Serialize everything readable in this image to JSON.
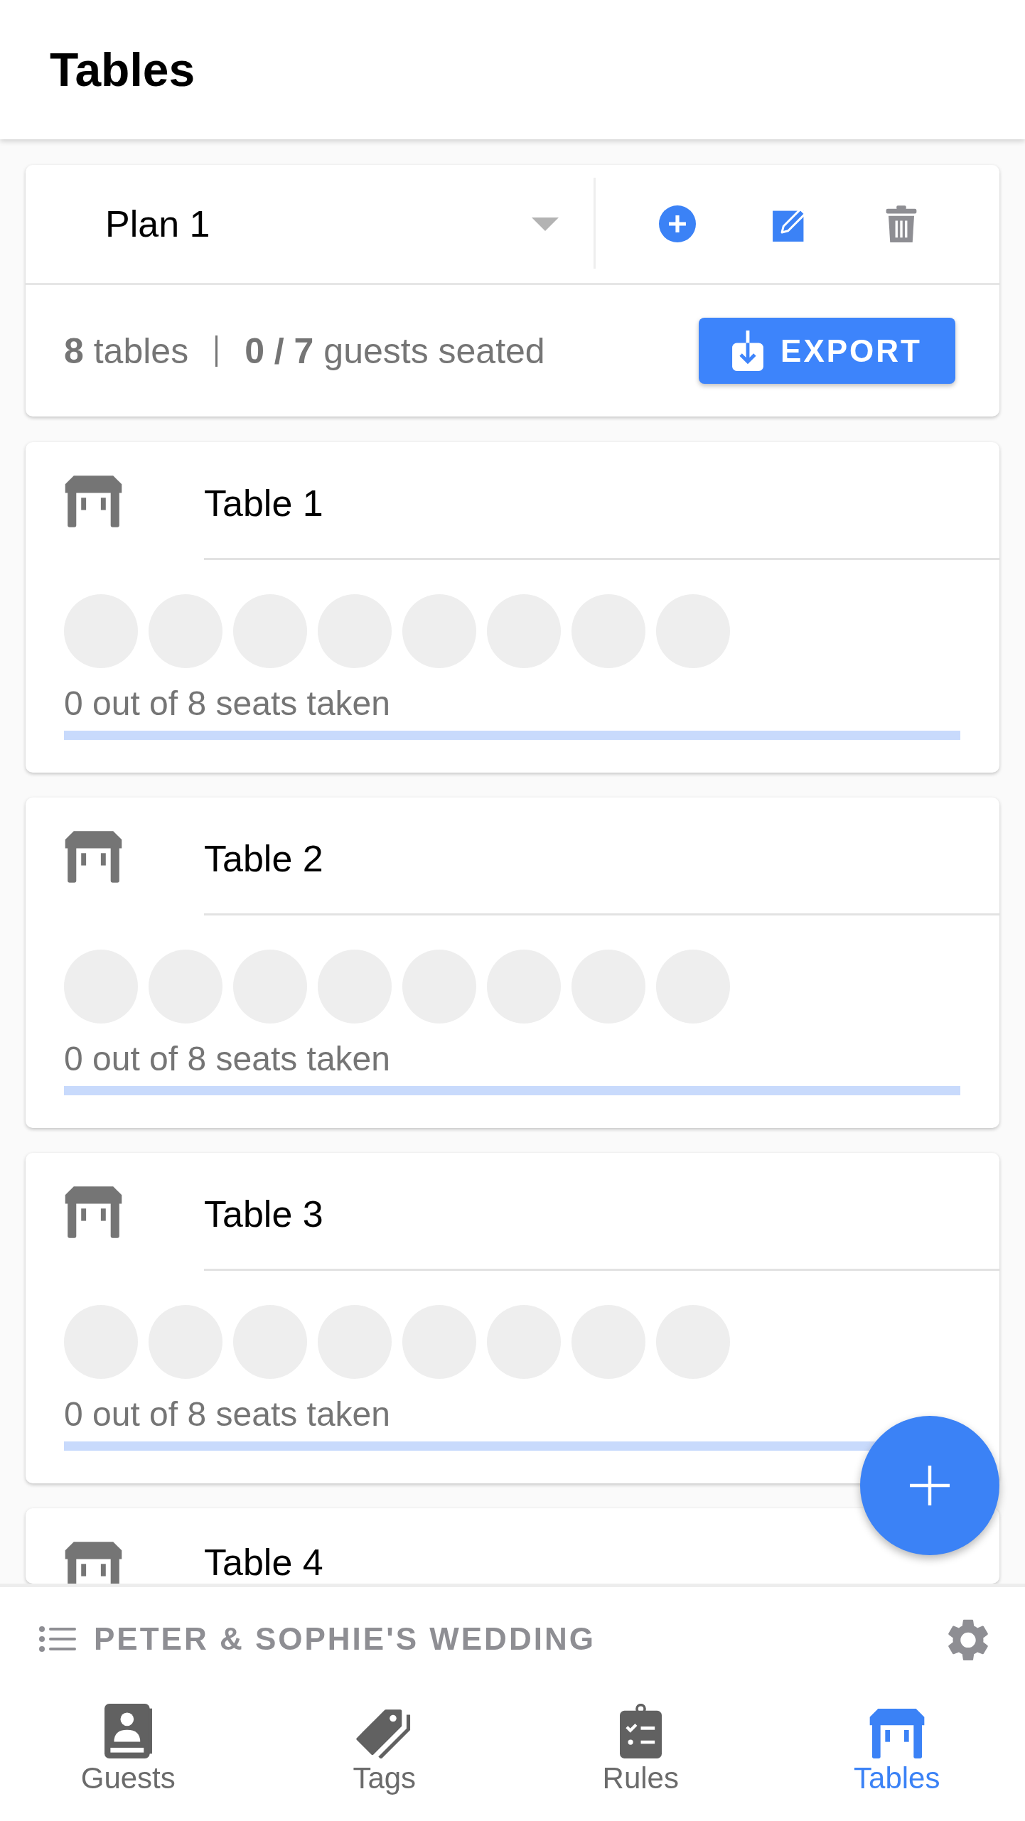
{
  "header": {
    "title": "Tables"
  },
  "plan": {
    "name": "Plan 1",
    "tables_summary": "**8** tables",
    "guests_summary": "**0 / 7** guests seated",
    "export_label": "EXPORT"
  },
  "tables": [
    {
      "name": "Table 1",
      "seats": [
        {
          "taken": false
        },
        {
          "taken": false
        },
        {
          "taken": false
        },
        {
          "taken": false
        },
        {
          "taken": false
        },
        {
          "taken": false
        },
        {
          "taken": false
        },
        {
          "taken": false
        }
      ],
      "status": "0 out of 8 seats taken",
      "level": 0
    },
    {
      "name": "Table 2",
      "seats": [
        {
          "taken": false
        },
        {
          "taken": false
        },
        {
          "taken": false
        },
        {
          "taken": false
        },
        {
          "taken": false
        },
        {
          "taken": false
        },
        {
          "taken": false
        },
        {
          "taken": false
        }
      ],
      "status": "0 out of 8 seats taken",
      "level": 0
    },
    {
      "name": "Table 3",
      "seats": [
        {
          "taken": false
        },
        {
          "taken": false
        },
        {
          "taken": false
        },
        {
          "taken": false
        },
        {
          "taken": false
        },
        {
          "taken": false
        },
        {
          "taken": false
        },
        {
          "taken": false
        }
      ],
      "status": "0 out of 8 seats taken",
      "level": 0
    },
    {
      "name": "Table 4"
    }
  ],
  "event": {
    "title": "PETER & SOPHIE'S WEDDING"
  },
  "nav": [
    {
      "kind": "guests",
      "label": "Guests",
      "selected": false
    },
    {
      "kind": "tags",
      "label": "Tags",
      "selected": false
    },
    {
      "kind": "rules",
      "label": "Rules",
      "selected": false
    },
    {
      "kind": "tables",
      "label": "Tables",
      "selected": true
    }
  ]
}
